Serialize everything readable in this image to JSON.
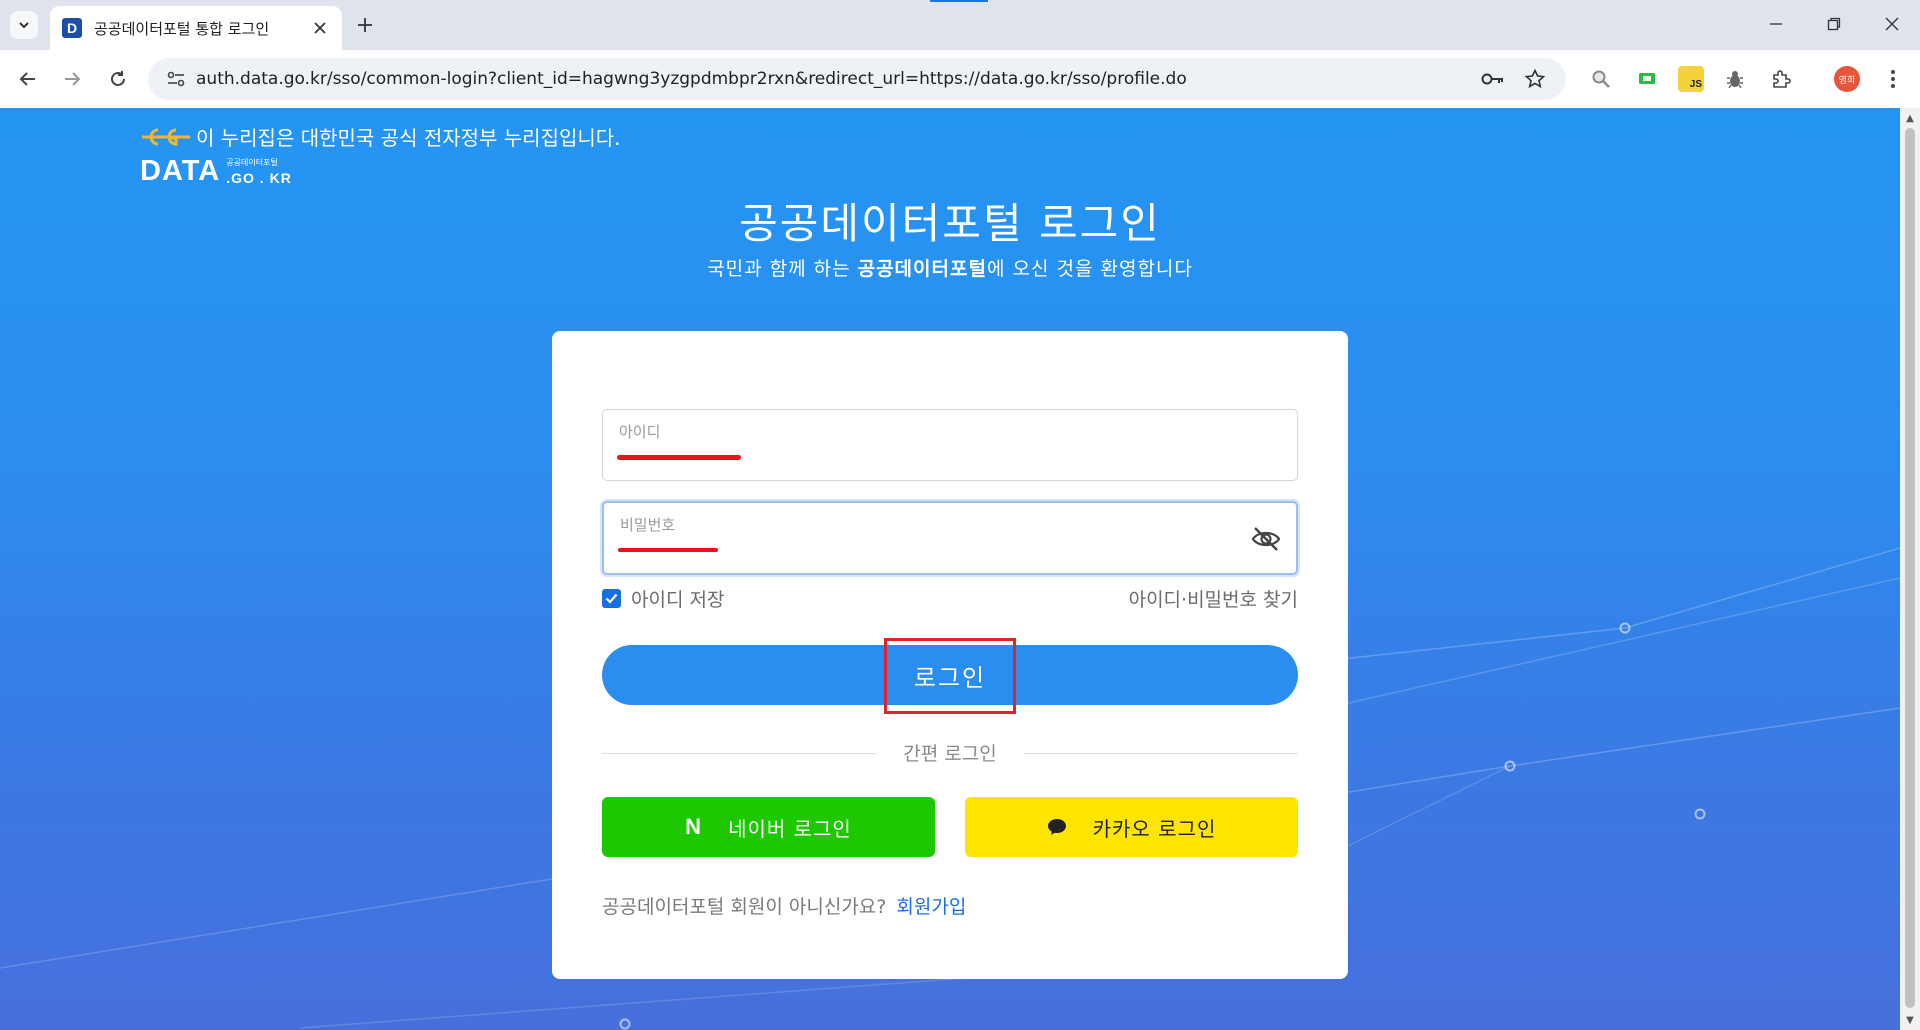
{
  "browser": {
    "tab_title": "공공데이터포털 통합 로그인",
    "favicon_letter": "D",
    "url": "auth.data.go.kr/sso/common-login?client_id=hagwng3yzgpdmbpr2rxn&redirect_url=https://data.go.kr/sso/profile.do",
    "profile_label": "영희",
    "extension_js_label": "JS",
    "icons": [
      "tab-list-icon",
      "close-icon",
      "plus-icon",
      "minimize-icon",
      "restore-icon",
      "window-close-icon",
      "back-arrow-icon",
      "forward-arrow-icon",
      "reload-icon",
      "site-info-icon",
      "key-icon",
      "star-icon",
      "extension-icon",
      "menu-icon"
    ]
  },
  "header": {
    "gov_notice": "이 누리집은 대한민국 공식 전자정부 누리집입니다.",
    "logo_main": "DATA",
    "logo_sub": "공공데이터포털",
    "logo_domain": ".GO . KR"
  },
  "page": {
    "title": "공공데이터포털 로그인",
    "subtitle_prefix": "국민과 함께 하는 ",
    "subtitle_bold": "공공데이터포털",
    "subtitle_suffix": "에 오신 것을 환영합니다"
  },
  "form": {
    "id_label": "아이디",
    "password_label": "비밀번호",
    "remember_label": "아이디 저장",
    "remember_checked": true,
    "find_link": "아이디·비밀번호 찾기",
    "login_button": "로그인",
    "easy_login_label": "간편 로그인",
    "naver_button": "네이버 로그인",
    "naver_icon_letter": "N",
    "kakao_button": "카카오 로그인",
    "signup_prompt": "공공데이터포털 회원이 아니신가요?",
    "signup_link": "회원가입"
  },
  "colors": {
    "primary": "#2a8df0",
    "naver": "#1ec800",
    "kakao": "#fee500",
    "highlight": "#e3232a"
  }
}
